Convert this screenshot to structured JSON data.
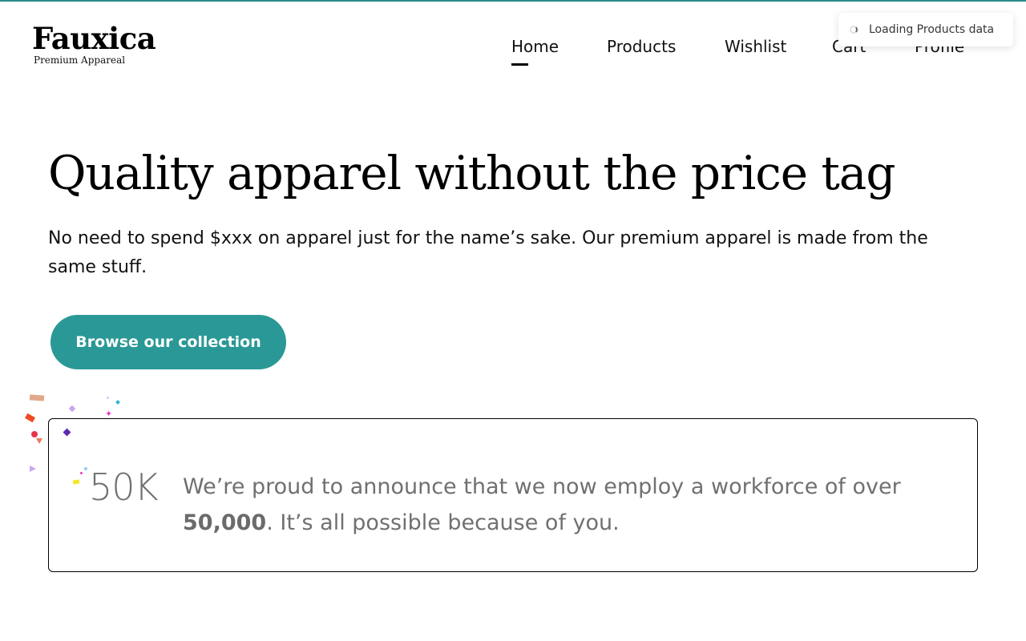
{
  "brand": {
    "name": "Fauxica",
    "tagline": "Premium Appareal",
    "accent": "#2a9896"
  },
  "nav": {
    "items": [
      {
        "label": "Home",
        "active": true
      },
      {
        "label": "Products",
        "active": false
      },
      {
        "label": "Wishlist",
        "active": false
      },
      {
        "label": "Cart",
        "active": false
      },
      {
        "label": "Profile",
        "active": false
      }
    ]
  },
  "toast": {
    "message": "Loading Products data",
    "icon": "spinner-icon"
  },
  "hero": {
    "title": "Quality apparel without the price tag",
    "subtitle": "No need to spend $xxx on apparel just for the name’s sake. Our premium apparel is made from the same stuff.",
    "cta_label": "Browse our collection"
  },
  "announcement": {
    "stat": "50K",
    "text_before": "We’re proud to announce that we now employ a workforce of over ",
    "highlight": "50,000",
    "text_after": ". It’s all possible because of you."
  }
}
